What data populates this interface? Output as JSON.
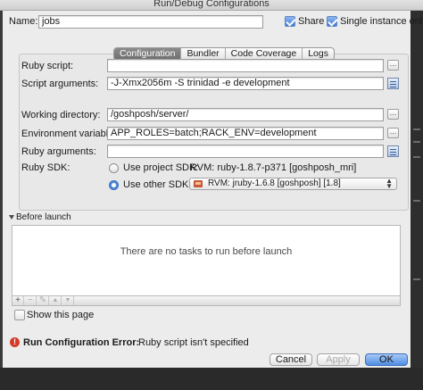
{
  "window": {
    "title": "Run/Debug Configurations"
  },
  "header": {
    "name_label": "Name:",
    "name_value": "jobs",
    "share_label": "Share",
    "single_instance_label": "Single instance only"
  },
  "tabs": [
    {
      "label": "Configuration",
      "active": true
    },
    {
      "label": "Bundler",
      "active": false
    },
    {
      "label": "Code Coverage",
      "active": false
    },
    {
      "label": "Logs",
      "active": false
    }
  ],
  "form": {
    "ruby_script_label": "Ruby script:",
    "ruby_script_value": "",
    "script_arguments_label": "Script arguments:",
    "script_arguments_value": "-J-Xmx2056m -S trinidad -e development",
    "working_directory_label": "Working directory:",
    "working_directory_value": "/goshposh/server/",
    "env_vars_label": "Environment variables:",
    "env_vars_value": "APP_ROLES=batch;RACK_ENV=development",
    "ruby_arguments_label": "Ruby arguments:",
    "ruby_arguments_value": "",
    "ruby_sdk_label": "Ruby SDK:",
    "use_project_sdk_label": "Use project SDK:",
    "project_sdk_value": "RVM: ruby-1.8.7-p371 [goshposh_mri]",
    "use_other_sdk_label": "Use other SDK:",
    "other_sdk_value": "RVM: jruby-1.6.8 [goshposh] [1.8]",
    "selected_sdk_option": "other"
  },
  "before_launch": {
    "title": "Before launch",
    "empty_text": "There are no tasks to run before launch",
    "toolbar": [
      "+",
      "−",
      "✎",
      "▲",
      "▼"
    ]
  },
  "show_page": {
    "label": "Show this page"
  },
  "error": {
    "bold_text": "Run Configuration Error:",
    "message": "Ruby script isn't specified"
  },
  "buttons": {
    "cancel": "Cancel",
    "apply": "Apply",
    "ok": "OK"
  },
  "icons": {
    "dots": "ellipsis-icon",
    "expand": "expand-table-icon",
    "rvm": "rvm-icon",
    "error": "error-icon"
  }
}
